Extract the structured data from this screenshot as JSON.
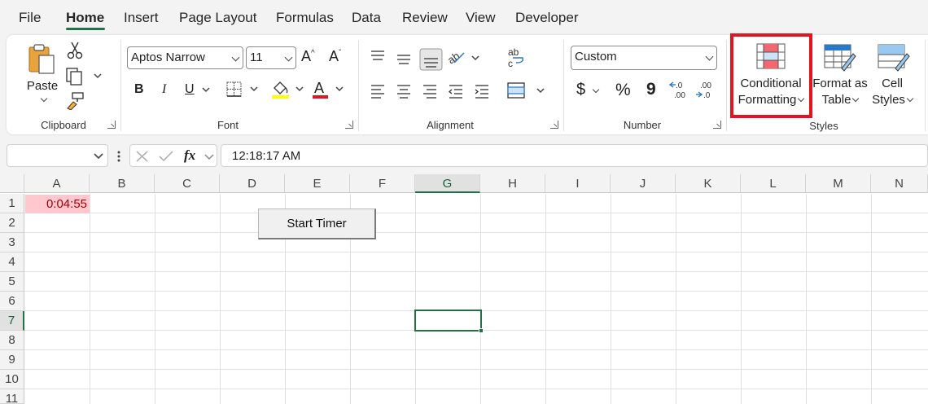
{
  "tabs": [
    "File",
    "Home",
    "Insert",
    "Page Layout",
    "Formulas",
    "Data",
    "Review",
    "View",
    "Developer"
  ],
  "active_tab": "Home",
  "ribbon": {
    "clipboard": {
      "paste_label": "Paste",
      "group_label": "Clipboard"
    },
    "font": {
      "font_name": "Aptos Narrow",
      "font_size": "11",
      "group_label": "Font",
      "bold": "B",
      "italic": "I",
      "underline": "U",
      "grow": "A^",
      "shrink": "Aˇ",
      "font_color": "#e3141f",
      "fill_color": "#ffff00"
    },
    "alignment": {
      "group_label": "Alignment"
    },
    "number": {
      "format": "Custom",
      "currency": "$",
      "percent": "%",
      "comma": "9",
      "inc_decimal": "←.0 .00",
      "dec_decimal": ".00 →.0",
      "group_label": "Number"
    },
    "styles": {
      "conditional_formatting": [
        "Conditional",
        "Formatting"
      ],
      "format_as_table": [
        "Format as",
        "Table"
      ],
      "cell_styles": [
        "Cell",
        "Styles"
      ],
      "group_label": "Styles"
    }
  },
  "formula_bar": {
    "name_box": "",
    "fx": "fx",
    "formula": "12:18:17 AM"
  },
  "grid": {
    "columns": [
      "A",
      "B",
      "C",
      "D",
      "E",
      "F",
      "G",
      "H",
      "I",
      "J",
      "K",
      "L",
      "M",
      "N"
    ],
    "rows": [
      "1",
      "2",
      "3",
      "4",
      "5",
      "6",
      "7",
      "8",
      "9",
      "10",
      "11"
    ],
    "selected_column": "G",
    "selected_row": "7",
    "cells": {
      "A1": "0:04:55"
    },
    "button_label": "Start Timer"
  },
  "colors": {
    "accent": "#217346",
    "highlight_box": "#e3141f",
    "bad_fill": "#ffc7ce",
    "bad_text": "#9c0006"
  }
}
